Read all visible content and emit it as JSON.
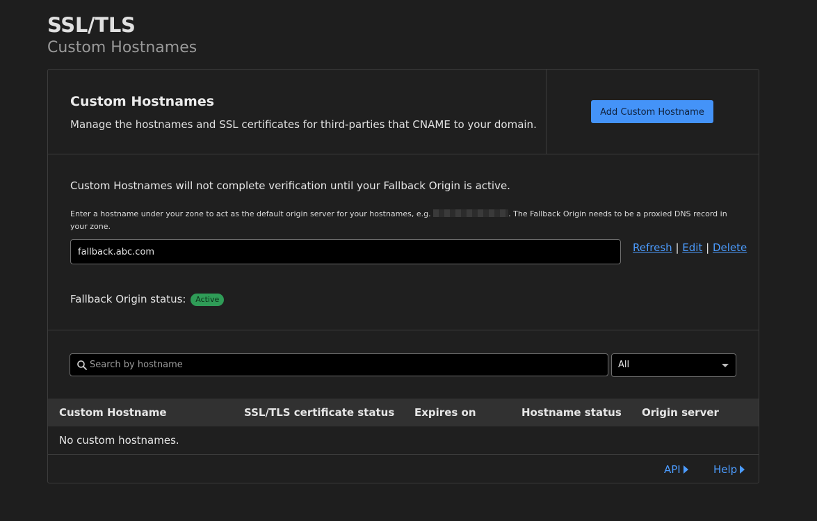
{
  "header": {
    "title": "SSL/TLS",
    "subtitle": "Custom Hostnames"
  },
  "intro": {
    "heading": "Custom Hostnames",
    "description": "Manage the hostnames and SSL certificates for third-parties that CNAME to your domain.",
    "add_button_label": "Add Custom Hostname"
  },
  "fallback": {
    "warning": "Custom Hostnames will not complete verification until your Fallback Origin is active.",
    "help_before": "Enter a hostname under your zone to act as the default origin server for your hostnames, e.g.",
    "help_after": ". The Fallback Origin needs to be a proxied DNS record in your zone.",
    "input_value": "fallback.abc.com",
    "links": {
      "refresh": "Refresh",
      "edit": "Edit",
      "delete": "Delete",
      "separator": "|"
    },
    "status_label": "Fallback Origin status:",
    "status_value": "Active"
  },
  "filters": {
    "search_placeholder": "Search by hostname",
    "status_filter_value": "All"
  },
  "table": {
    "columns": [
      "Custom Hostname",
      "SSL/TLS certificate status",
      "Expires on",
      "Hostname status",
      "Origin server"
    ],
    "empty_message": "No custom hostnames."
  },
  "footer": {
    "api_label": "API",
    "help_label": "Help"
  },
  "colors": {
    "background": "#1e1e1e",
    "primary_button": "#4493f8",
    "link": "#4c9cff",
    "active_badge": "#2f9c57"
  }
}
